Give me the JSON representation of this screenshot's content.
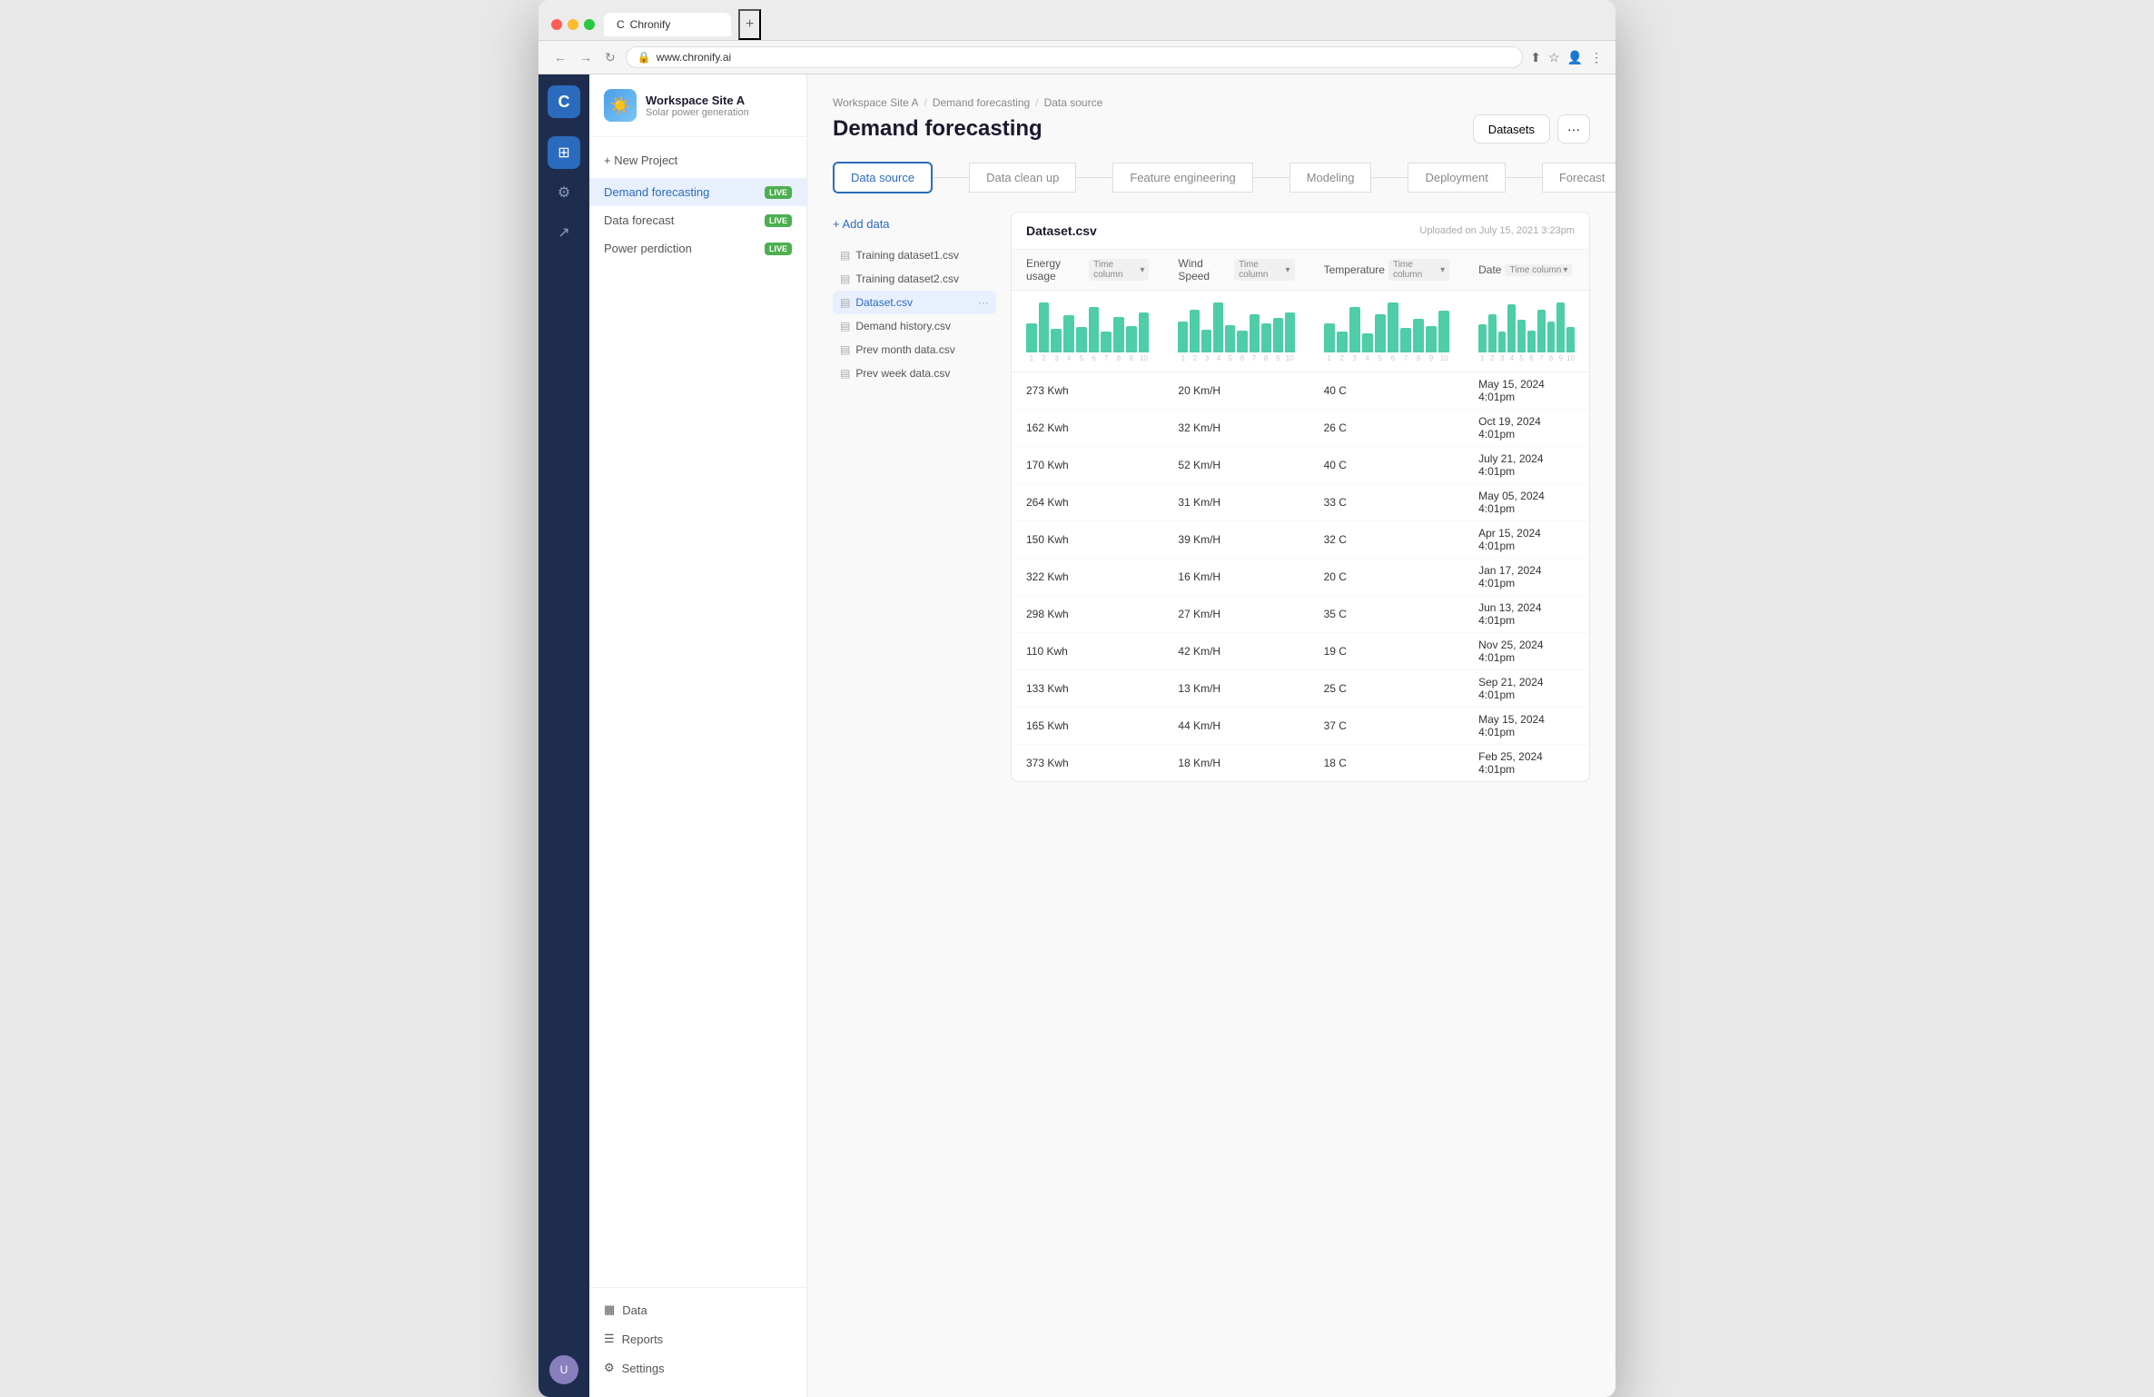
{
  "browser": {
    "tab_title": "Chronify",
    "url": "www.chronify.ai",
    "tab_new": "+"
  },
  "workspace": {
    "name": "Workspace Site A",
    "subtitle": "Solar power generation",
    "icon": "☀️"
  },
  "sidebar": {
    "new_project": "+ New Project",
    "projects": [
      {
        "name": "Demand forecasting",
        "badge": "LIVE",
        "active": true
      },
      {
        "name": "Data forecast",
        "badge": "LIVE",
        "active": false
      },
      {
        "name": "Power perdiction",
        "badge": "LIVE",
        "active": false
      }
    ],
    "bottom": [
      {
        "icon": "▦",
        "label": "Data"
      },
      {
        "icon": "☰",
        "label": "Reports"
      },
      {
        "icon": "⚙",
        "label": "Settings"
      }
    ]
  },
  "breadcrumb": {
    "parts": [
      "Workspace Site A",
      "Demand forecasting",
      "Data source"
    ]
  },
  "page": {
    "title": "Demand forecasting",
    "datasets_btn": "Datasets",
    "more_btn": "···"
  },
  "pipeline": {
    "tabs": [
      {
        "label": "Data source",
        "active": true
      },
      {
        "label": "Data clean up",
        "active": false
      },
      {
        "label": "Feature engineering",
        "active": false
      },
      {
        "label": "Modeling",
        "active": false
      },
      {
        "label": "Deployment",
        "active": false
      },
      {
        "label": "Forecast",
        "active": false
      }
    ]
  },
  "files": {
    "add_label": "+ Add data",
    "list": [
      {
        "name": "Training dataset1.csv",
        "active": false
      },
      {
        "name": "Training dataset2.csv",
        "active": false
      },
      {
        "name": "Dataset.csv",
        "active": true
      },
      {
        "name": "Demand history.csv",
        "active": false
      },
      {
        "name": "Prev month data.csv",
        "active": false
      },
      {
        "name": "Prev week data.csv",
        "active": false
      }
    ]
  },
  "dataset": {
    "filename": "Dataset.csv",
    "upload_info": "Uploaded on July 15, 2021 3:23pm",
    "columns": [
      {
        "name": "Energy usage",
        "tag": "Time column"
      },
      {
        "name": "Wind Speed",
        "tag": "Time column"
      },
      {
        "name": "Temperature",
        "tag": "Time column"
      },
      {
        "name": "Date",
        "tag": "Time column"
      }
    ],
    "charts": {
      "energy_usage": [
        35,
        60,
        28,
        45,
        30,
        55,
        25,
        42,
        32,
        48
      ],
      "wind_speed": [
        40,
        55,
        30,
        65,
        35,
        28,
        50,
        38,
        45,
        52
      ],
      "temperature": [
        42,
        30,
        65,
        28,
        55,
        72,
        35,
        48,
        38,
        60
      ],
      "date": [
        38,
        52,
        28,
        65,
        45,
        30,
        58,
        42,
        68,
        35
      ]
    },
    "rows": [
      [
        "273 Kwh",
        "20 Km/H",
        "40 C",
        "May 15, 2024 4:01pm"
      ],
      [
        "162 Kwh",
        "32 Km/H",
        "26 C",
        "Oct 19, 2024 4:01pm"
      ],
      [
        "170 Kwh",
        "52 Km/H",
        "40 C",
        "July 21, 2024 4:01pm"
      ],
      [
        "264 Kwh",
        "31 Km/H",
        "33 C",
        "May 05, 2024 4:01pm"
      ],
      [
        "150 Kwh",
        "39 Km/H",
        "32 C",
        "Apr 15, 2024 4:01pm"
      ],
      [
        "322 Kwh",
        "16 Km/H",
        "20 C",
        "Jan 17, 2024 4:01pm"
      ],
      [
        "298 Kwh",
        "27 Km/H",
        "35 C",
        "Jun 13, 2024 4:01pm"
      ],
      [
        "110 Kwh",
        "42 Km/H",
        "19 C",
        "Nov 25, 2024 4:01pm"
      ],
      [
        "133 Kwh",
        "13 Km/H",
        "25 C",
        "Sep 21, 2024 4:01pm"
      ],
      [
        "165 Kwh",
        "44 Km/H",
        "37 C",
        "May 15, 2024 4:01pm"
      ],
      [
        "373 Kwh",
        "18 Km/H",
        "18 C",
        "Feb 25, 2024 4:01pm"
      ]
    ]
  },
  "chart_labels": [
    "1",
    "2",
    "3",
    "4",
    "5",
    "6",
    "7",
    "8",
    "9",
    "10"
  ]
}
